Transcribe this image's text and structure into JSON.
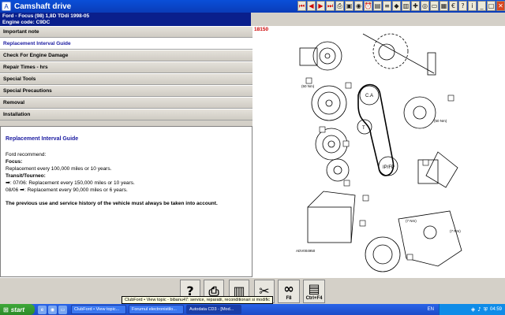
{
  "window": {
    "title": "Camshaft drive",
    "toolbar_icons": [
      "skip-back-icon",
      "prev-icon",
      "next-icon",
      "skip-forward-icon",
      "print-icon",
      "image-icon",
      "camera-icon",
      "alarm-icon",
      "folder-icon",
      "stats-icon",
      "car-icon",
      "book-icon",
      "tools-icon",
      "wheel-icon",
      "ruler-icon",
      "chart-icon",
      "euro-icon",
      "help-icon",
      "info-icon",
      "minimize-icon",
      "maximize-icon",
      "close-icon"
    ]
  },
  "vehicle": {
    "line1": "Ford - Focus (98) 1,8D TDdi 1998-05",
    "line2": "Engine code: C9DC"
  },
  "menu": [
    {
      "label": "Important note",
      "active": false
    },
    {
      "label": "Replacement Interval Guide",
      "active": true
    },
    {
      "label": "Check For Engine Damage",
      "active": false
    },
    {
      "label": "Repair Times - hrs",
      "active": false
    },
    {
      "label": "Special Tools",
      "active": false
    },
    {
      "label": "Special Precautions",
      "active": false
    },
    {
      "label": "Removal",
      "active": false
    },
    {
      "label": "Installation",
      "active": false
    }
  ],
  "description": {
    "heading": "Replacement Interval Guide",
    "intro": "Ford recommend:",
    "focus_label": "Focus:",
    "focus_text": "Replacement every 100,000 miles or 10 years.",
    "transit_label": "Transit/Tourneo:",
    "transit_line1": ": 07/06: Replacement every 150,000 miles or 10 years.",
    "transit_line2_prefix": "08/06",
    "transit_line2": ": Replacement every 90,000 miles or 6 years.",
    "warning": "The previous use and service history of the vehicle must always be taken into account."
  },
  "diagram": {
    "code": "18150",
    "ref": "ADV004950"
  },
  "bottom": {
    "f8": "F8",
    "ctrl_f4": "Ctrl+F4",
    "tooltip": "ClubFord • View topic - bibanu47: service, reparatii, reconditionari si modific"
  },
  "taskbar": {
    "start": "start",
    "tasks": [
      {
        "label": "ClubFord • View topic...",
        "active": false
      },
      {
        "label": "Forumul electronistilo...",
        "active": false
      },
      {
        "label": "Autodata CD3 - [Mod...",
        "active": true
      }
    ],
    "lang": "EN",
    "clock": "04:59"
  }
}
